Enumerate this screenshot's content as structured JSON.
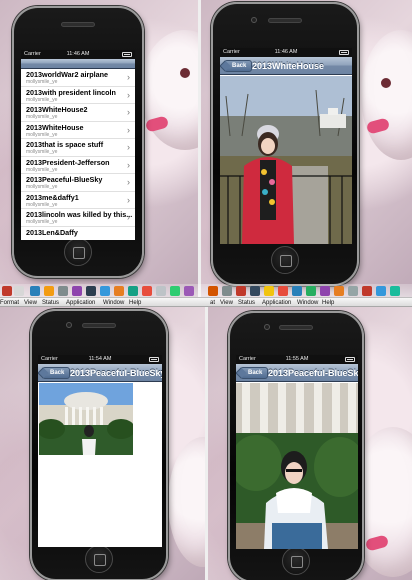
{
  "status_bar": {
    "carrier": "Carrier",
    "time_1": "11:46 AM",
    "time_2": "11:46 AM",
    "time_3": "11:54 AM",
    "time_4": "11:55 AM"
  },
  "list": {
    "items": [
      {
        "title": "2013worldWar2 airplane",
        "subtitle": "mollysmile_ye"
      },
      {
        "title": "2013with president lincoln",
        "subtitle": "mollysmile_ye"
      },
      {
        "title": "2013WhiteHouse2",
        "subtitle": "mollysmile_ye"
      },
      {
        "title": "2013WhiteHouse",
        "subtitle": "mollysmile_ye"
      },
      {
        "title": "2013that is space stuff",
        "subtitle": "mollysmile_ye"
      },
      {
        "title": "2013President-Jefferson",
        "subtitle": "mollysmile_ye"
      },
      {
        "title": "2013Peaceful-BlueSky",
        "subtitle": "mollysmile_ye"
      },
      {
        "title": "2013me&daffy1",
        "subtitle": "mollysmile_ye"
      },
      {
        "title": "2013lincoln was killed by this...",
        "subtitle": "mollysmile_ye"
      },
      {
        "title": "2013Len&Daffy",
        "subtitle": ""
      }
    ]
  },
  "detail_1": {
    "back": "Back",
    "title": "2013WhiteHouse"
  },
  "detail_2": {
    "back": "Back",
    "title": "2013Peaceful-BlueSky"
  },
  "detail_3": {
    "back": "Back",
    "title": "2013Peaceful-BlueSky"
  },
  "menubar": {
    "items": [
      "Format",
      "View",
      "Status",
      "Application",
      "Window",
      "Help"
    ],
    "items_right": [
      "at",
      "View",
      "Status",
      "Application",
      "Window",
      "Help"
    ]
  },
  "icons": {
    "chevron": "›",
    "back_arrow": "back-arrow-icon",
    "home": "home-button-icon"
  },
  "colors": {
    "navbar": "#8ea2bb",
    "statusbar": "#101010",
    "accent": "#e24f7b"
  }
}
